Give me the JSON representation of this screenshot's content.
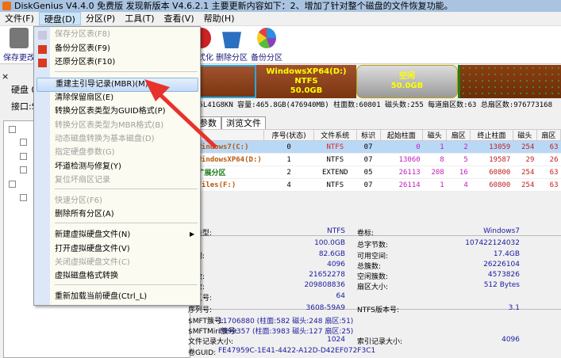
{
  "window": {
    "title": "DiskGenius V4.4.0 免费版  发现新版本 V4.6.2.1 主要更新内容如下：2、增加了针对整个磁盘的文件恢复功能。"
  },
  "menubar": [
    "文件(F)",
    "硬盘(D)",
    "分区(P)",
    "工具(T)",
    "查看(V)",
    "帮助(H)"
  ],
  "toolbar": {
    "save": "保存更改",
    "format": "格式化",
    "delete": "删除分区",
    "backup": "备份分区"
  },
  "left": {
    "disk_label": "硬盘 0",
    "interface": "接口:S"
  },
  "diskbar": [
    {
      "name": "",
      "fs": "",
      "size": "",
      "color": "#8b3a10"
    },
    {
      "name": "WindowsXP64(D:)",
      "fs": "NTFS",
      "size": "50.0GB",
      "color": "#8b3e10"
    },
    {
      "name": "空闲",
      "fs": "",
      "size": "50.0GB",
      "color": "#a9a9a9"
    },
    {
      "name": "",
      "fs": "",
      "size": "",
      "color": "#7a3510"
    }
  ],
  "disk_info": "55L41G8KN  容量:465.8GB(476940MB)  柱面数:60801  磁头数:255  每道扇区数:63  总扇区数:976773168",
  "tabs": [
    "参数",
    "浏览文件"
  ],
  "table": {
    "headers": [
      "",
      "序号(状态)",
      "文件系统",
      "标识",
      "起始柱面",
      "磁头",
      "扇区",
      "终止柱面",
      "磁头",
      "扇区"
    ],
    "rows": [
      [
        "Windows7(C:)",
        "0",
        "NTFS",
        "07",
        "0",
        "1",
        "2",
        "13059",
        "254",
        "63"
      ],
      [
        "WindowsXP64(D:)",
        "1",
        "NTFS",
        "07",
        "13060",
        "8",
        "5",
        "19587",
        "29",
        "26"
      ],
      [
        "扩展分区",
        "2",
        "EXTEND",
        "05",
        "26113",
        "208",
        "16",
        "60800",
        "254",
        "63"
      ],
      [
        "Files(F:)",
        "4",
        "NTFS",
        "07",
        "26114",
        "1",
        "4",
        "60800",
        "254",
        "63"
      ]
    ]
  },
  "details": {
    "rows": [
      [
        "统类型:",
        "NTFS",
        "卷标:",
        "Windows7"
      ],
      [
        "量:",
        "100.0GB",
        "总字节数:",
        "107422124032"
      ],
      [
        "空间:",
        "82.6GB",
        "可用空间:",
        "17.4GB"
      ],
      [
        ":",
        "4096",
        "总簇数:",
        "26226104"
      ],
      [
        "簇数:",
        "21652278",
        "空闲簇数:",
        "4573826"
      ],
      [
        "区数:",
        "209808836",
        "扇区大小:",
        "512 Bytes"
      ],
      [
        "扇区号:",
        "64",
        "",
        ""
      ],
      [
        "序列号:",
        "3608-59A9",
        "NTFS版本号:",
        "3.1"
      ],
      [
        "$MFT簇号:",
        "11706880 (柱面:582 磁头:248 扇区:51)",
        "",
        ""
      ],
      [
        "$MFTMirr簇号:",
        "7999357 (柱面:3983 磁头:127 扇区:25)",
        "",
        ""
      ],
      [
        "文件记录大小:",
        "1024",
        "索引记录大小:",
        "4096"
      ],
      [
        "卷GUID:",
        "FE47959C-1E41-4422-A12D-D42EF072F3C1",
        "",
        ""
      ]
    ]
  },
  "menu": {
    "items": [
      {
        "label": "保存分区表(F8)",
        "disabled": true
      },
      {
        "label": "备份分区表(F9)"
      },
      {
        "label": "还原分区表(F10)"
      },
      {
        "label": "重建主引导记录(MBR)(M)",
        "highlighted": true
      },
      {
        "label": "清除保留扇区(E)"
      },
      {
        "label": "转换分区表类型为GUID格式(P)"
      },
      {
        "label": "转换分区表类型为MBR格式(B)",
        "disabled": true
      },
      {
        "label": "动态磁盘转换为基本磁盘(D)",
        "disabled": true
      },
      {
        "label": "指定硬盘参数(G)",
        "disabled": true
      },
      {
        "label": "坏道检测与修复(Y)"
      },
      {
        "label": "复位坏扇区记录",
        "disabled": true
      },
      {
        "label": "快速分区(F6)",
        "disabled": true
      },
      {
        "label": "删除所有分区(A)"
      },
      {
        "label": "新建虚拟硬盘文件(N)",
        "submenu": true
      },
      {
        "label": "打开虚拟硬盘文件(V)"
      },
      {
        "label": "关闭虚拟硬盘文件(C)",
        "disabled": true
      },
      {
        "label": "虚拟磁盘格式转换"
      },
      {
        "label": "重新加载当前硬盘(Ctrl_L)"
      }
    ]
  },
  "colors": {
    "highlight_row": "#b9d8f6",
    "arrow": "#e8322d",
    "title_bar": "#a9c3e0"
  }
}
